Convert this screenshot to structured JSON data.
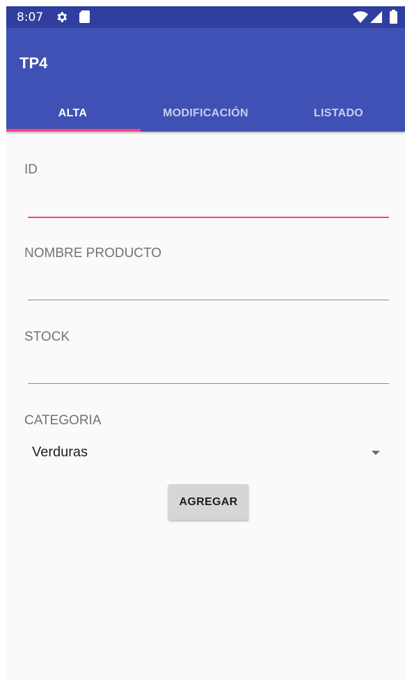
{
  "status_bar": {
    "time": "8:07",
    "icons": [
      "gear-icon",
      "sd-card-icon",
      "wifi-icon",
      "signal-icon",
      "battery-icon"
    ]
  },
  "app_bar": {
    "title": "TP4",
    "background": "#3f51b5",
    "status_background": "#303f9f",
    "accent": "#ff4081"
  },
  "tabs": [
    {
      "label": "ALTA",
      "active": true
    },
    {
      "label": "MODIFICACIÓN",
      "active": false
    },
    {
      "label": "LISTADO",
      "active": false
    }
  ],
  "form": {
    "id_field": {
      "label": "ID",
      "value": ""
    },
    "name_field": {
      "label": "NOMBRE PRODUCTO",
      "value": ""
    },
    "stock_field": {
      "label": "STOCK",
      "value": ""
    },
    "category": {
      "label": "CATEGORIA",
      "selected": "Verduras"
    },
    "submit_label": "AGREGAR"
  }
}
